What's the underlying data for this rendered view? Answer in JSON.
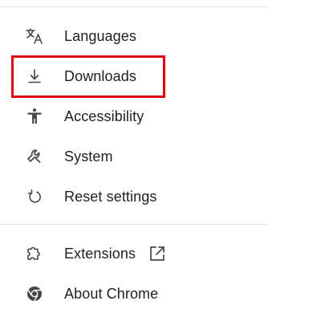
{
  "menu": {
    "items": [
      {
        "label": "Languages",
        "icon": "translate-icon"
      },
      {
        "label": "Downloads",
        "icon": "download-icon"
      },
      {
        "label": "Accessibility",
        "icon": "accessibility-icon"
      },
      {
        "label": "System",
        "icon": "wrench-icon"
      },
      {
        "label": "Reset settings",
        "icon": "reset-icon"
      }
    ],
    "footer_items": [
      {
        "label": "Extensions",
        "icon": "extension-icon",
        "trailing_icon": "open-external-icon"
      },
      {
        "label": "About Chrome",
        "icon": "chrome-logo-icon"
      }
    ]
  },
  "highlight": {
    "target": "Downloads",
    "color": "#e0000f"
  },
  "colors": {
    "text": "#1f1f1f",
    "icon": "#474747",
    "divider": "#e3e3e3"
  }
}
